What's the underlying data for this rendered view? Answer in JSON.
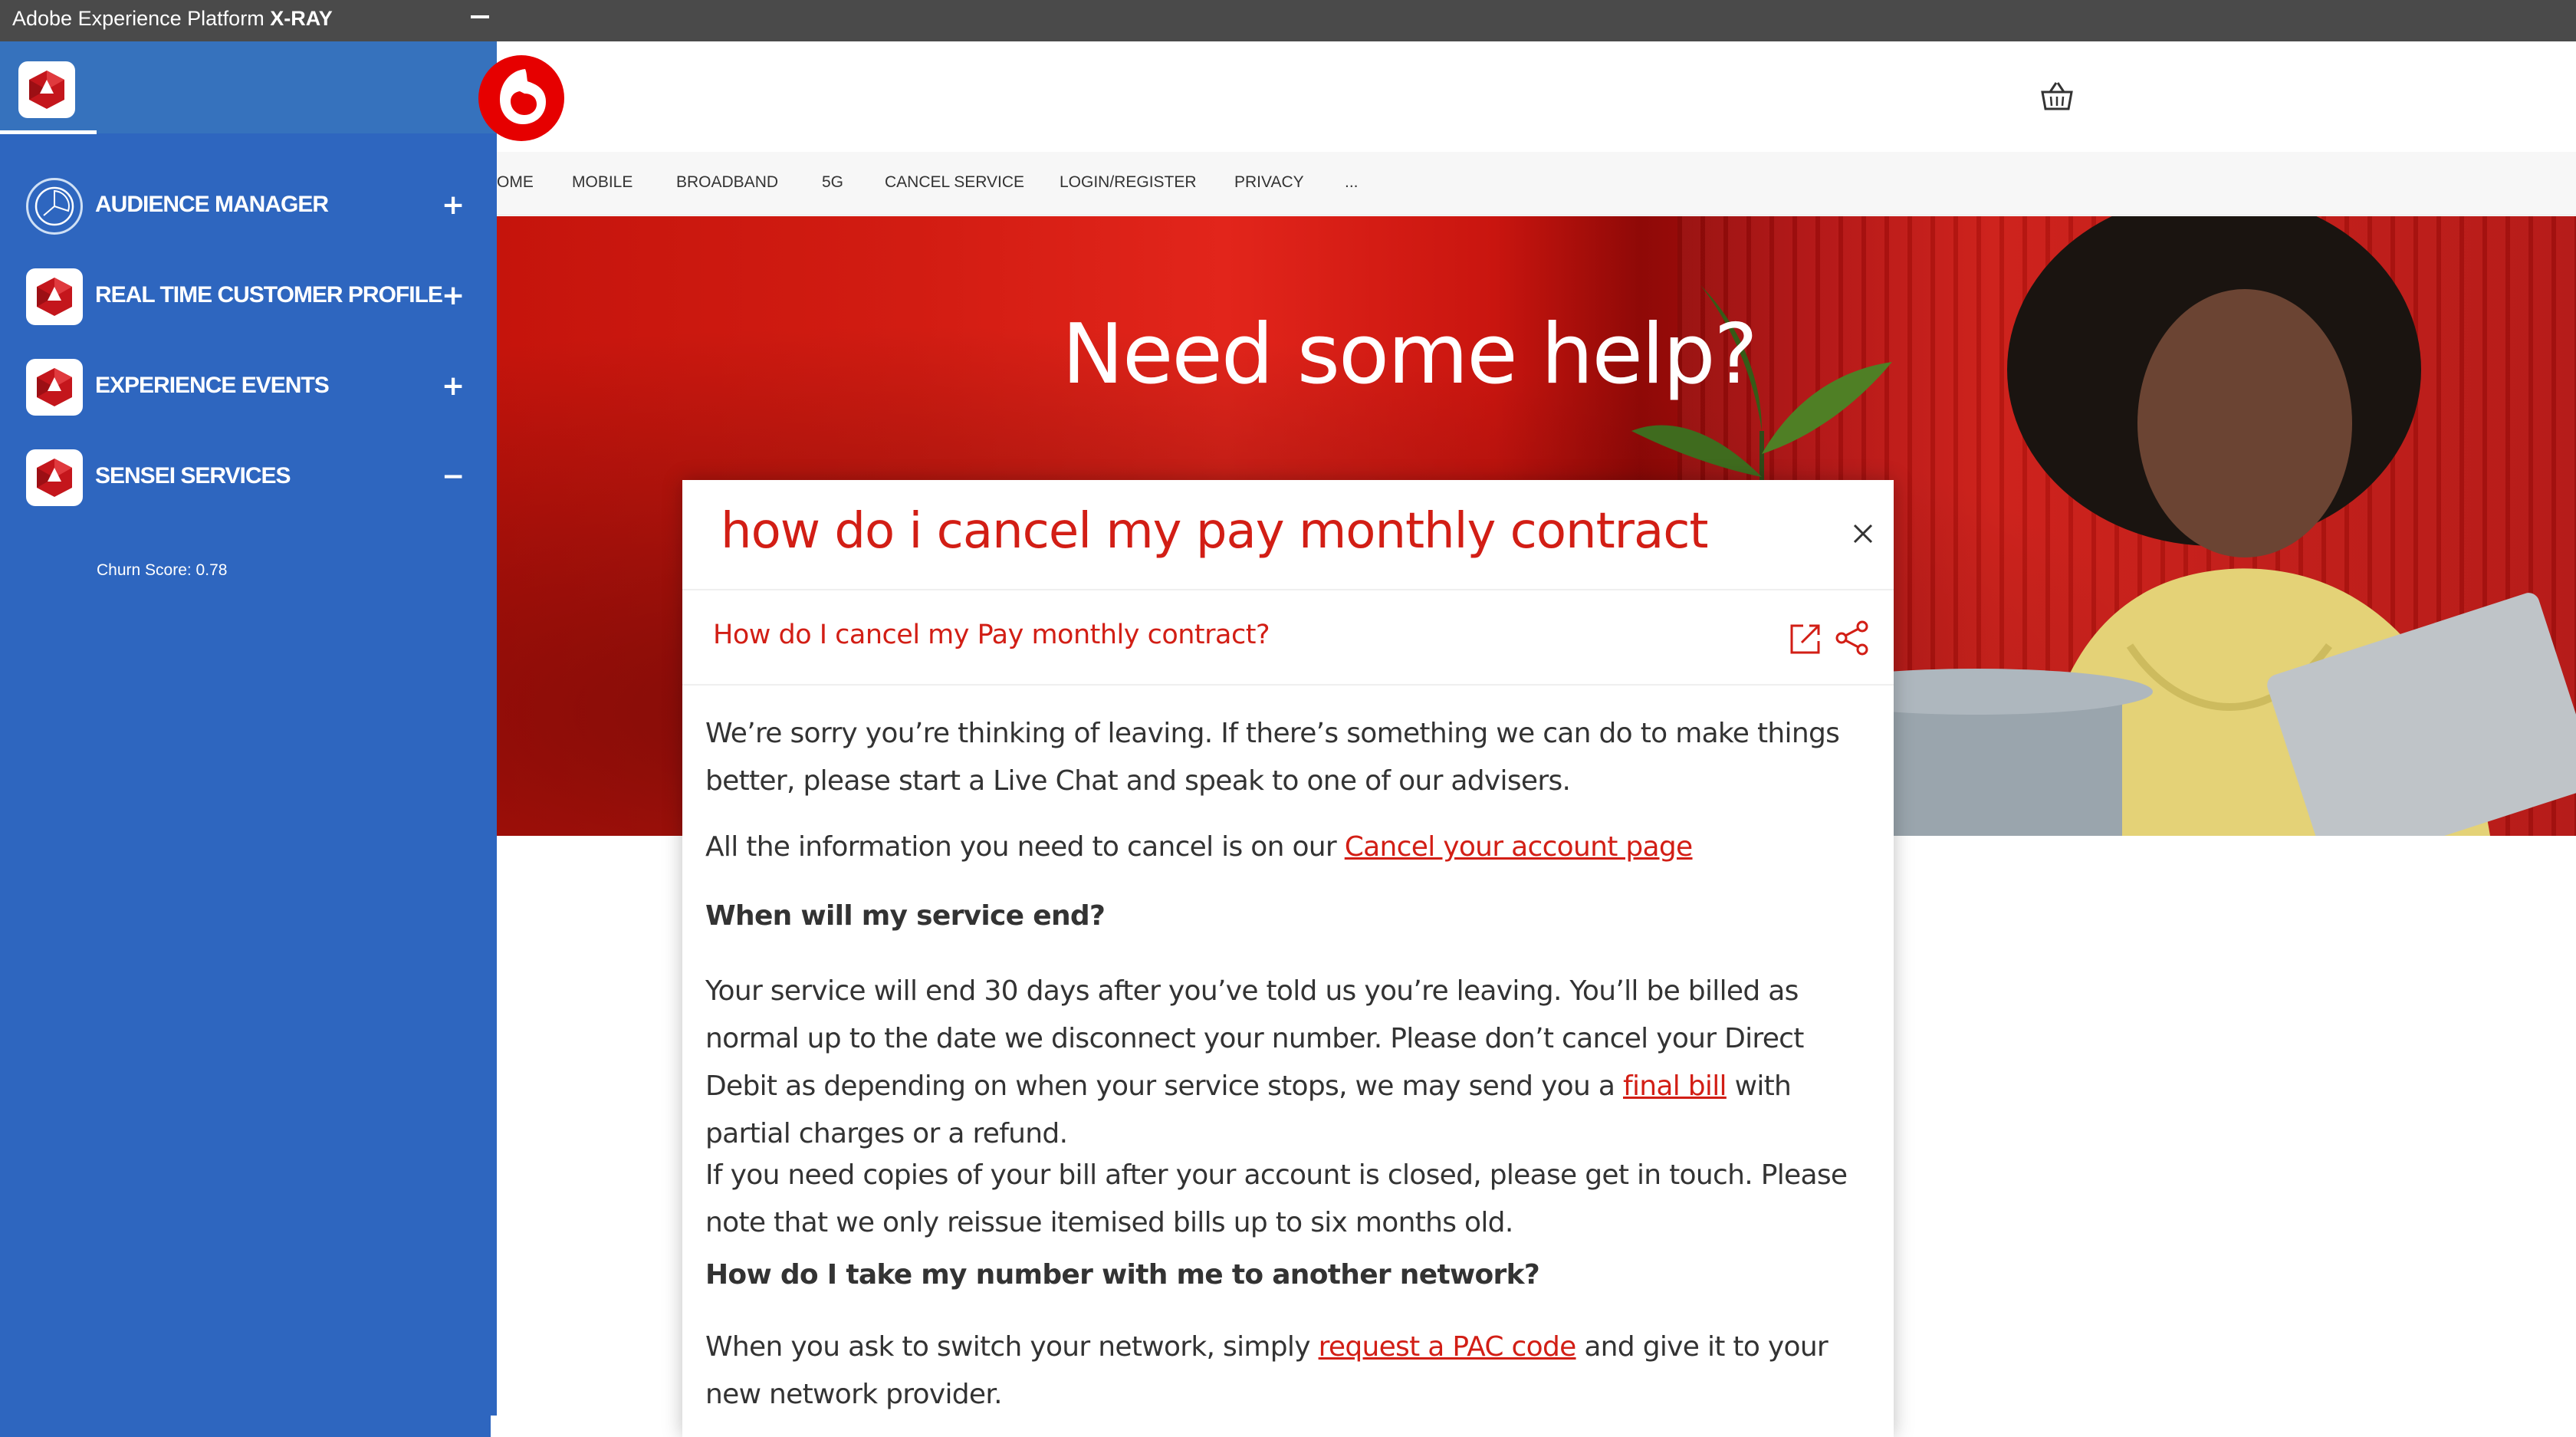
{
  "xray": {
    "title_prefix": "Adobe Experience Platform",
    "title_bold": "X-RAY"
  },
  "panel": {
    "items": [
      {
        "label": "AUDIENCE MANAGER",
        "toggle": "+"
      },
      {
        "label": "REAL TIME CUSTOMER PROFILE",
        "toggle": "+"
      },
      {
        "label": "EXPERIENCE EVENTS",
        "toggle": "+"
      },
      {
        "label": "SENSEI SERVICES",
        "toggle": "−"
      }
    ],
    "churn_score": "Churn Score: 0.78"
  },
  "site": {
    "nav": [
      "OME",
      "MOBILE",
      "BROADBAND",
      "5G",
      "CANCEL SERVICE",
      "LOGIN/REGISTER",
      "PRIVACY",
      "..."
    ],
    "hero_title": "Need some help?"
  },
  "dialog": {
    "search_query": "how do i cancel my pay monthly contract",
    "result_title": "How do I cancel my Pay monthly contract?",
    "p1": "We’re sorry you’re thinking of leaving. If there’s something we can do to make things better, please start a Live Chat and speak to one of our advisers.",
    "p2_text": "All the information you need to cancel is on our ",
    "p2_link": "Cancel your account page",
    "h1": "When will my service end?",
    "p3_text": "Your service will end 30 days after you’ve told us you’re leaving. You’ll be billed as normal up to the date we disconnect your number. Please don’t cancel your Direct Debit as depending on when your service stops, we may send you a ",
    "p3_link": "final bill",
    "p3_tail": " with partial charges or a refund.",
    "p4": "If you need copies of your bill after your account is closed, please get in touch. Please note that we only reissue itemised bills up to six months old.",
    "h2": "How do I take my number with me to another network?",
    "p5_text": "When you ask to switch your network, simply ",
    "p5_link": "request a PAC code",
    "p5_tail": " and give it to your new network provider."
  },
  "colors": {
    "brand_red": "#d21e15",
    "panel_blue": "#2e66bf",
    "xray_bar": "#4a4a4a"
  },
  "icons": [
    "aep-logo-icon",
    "audience-manager-icon",
    "profile-icon",
    "experience-events-icon",
    "sensei-icon",
    "vodafone-logo-icon",
    "basket-icon",
    "close-icon",
    "open-external-icon",
    "share-icon"
  ]
}
